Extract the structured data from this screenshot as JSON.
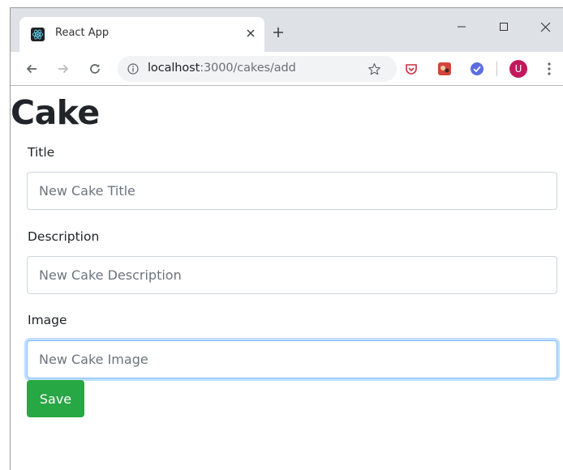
{
  "browser": {
    "tab_title": "React App",
    "url_host": "localhost",
    "url_path": ":3000/cakes/add",
    "avatar_initial": "U",
    "icons": {
      "favicon": "react-logo-icon",
      "new_tab": "plus-icon",
      "close_tab": "close-icon",
      "back": "arrow-left-icon",
      "forward": "arrow-right-icon",
      "reload": "reload-icon",
      "info": "info-icon",
      "bookmark": "star-icon",
      "menu": "kebab-menu-icon"
    }
  },
  "page": {
    "title": "Cake",
    "fields": [
      {
        "label": "Title",
        "placeholder": "New Cake Title"
      },
      {
        "label": "Description",
        "placeholder": "New Cake Description"
      },
      {
        "label": "Image",
        "placeholder": "New Cake Image"
      }
    ],
    "save_label": "Save"
  },
  "colors": {
    "save_button": "#28a745",
    "focus_border": "#80bdff",
    "avatar": "#c2185b",
    "tabstrip": "#dee1e6"
  }
}
